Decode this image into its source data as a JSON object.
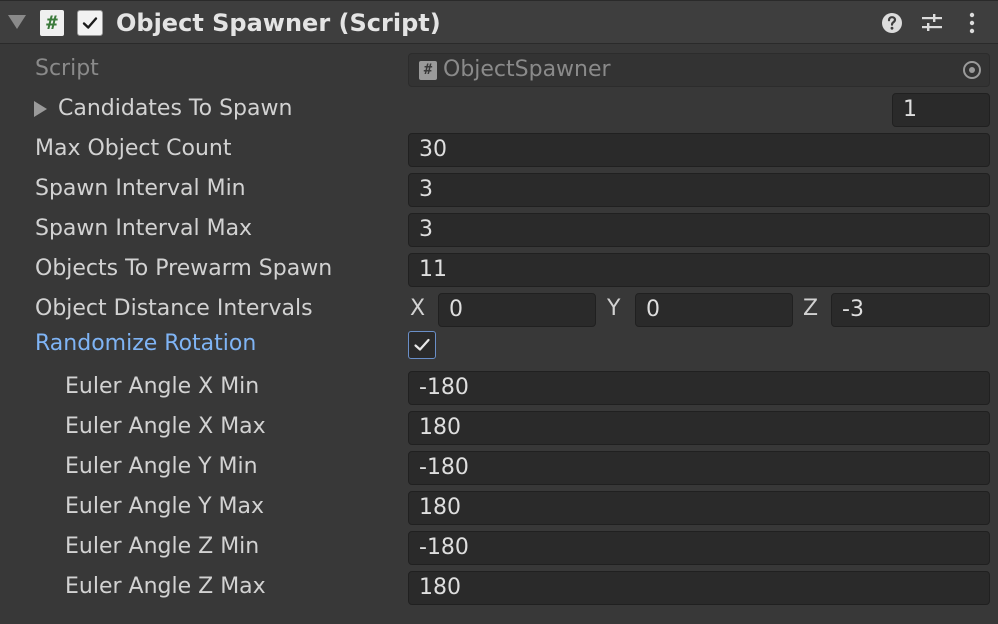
{
  "header": {
    "title": "Object Spawner (Script)",
    "script_glyph": "#",
    "enabled": true,
    "icons": [
      "help-icon",
      "preset-icon",
      "menu-icon"
    ]
  },
  "fields": {
    "script": {
      "label": "Script",
      "value": "ObjectSpawner"
    },
    "candidates": {
      "label": "Candidates To Spawn",
      "value": "1"
    },
    "max_object_count": {
      "label": "Max Object Count",
      "value": "30"
    },
    "spawn_interval_min": {
      "label": "Spawn Interval Min",
      "value": "3"
    },
    "spawn_interval_max": {
      "label": "Spawn Interval Max",
      "value": "3"
    },
    "objects_to_prewarm": {
      "label": "Objects To Prewarm Spawn",
      "value": "11"
    },
    "object_distance_intervals": {
      "label": "Object Distance Intervals",
      "x_label": "X",
      "x": "0",
      "y_label": "Y",
      "y": "0",
      "z_label": "Z",
      "z": "-3"
    },
    "randomize_rotation": {
      "label": "Randomize Rotation",
      "checked": true
    },
    "euler_x_min": {
      "label": "Euler Angle X Min",
      "value": "-180"
    },
    "euler_x_max": {
      "label": "Euler Angle X Max",
      "value": "180"
    },
    "euler_y_min": {
      "label": "Euler Angle Y Min",
      "value": "-180"
    },
    "euler_y_max": {
      "label": "Euler Angle Y Max",
      "value": "180"
    },
    "euler_z_min": {
      "label": "Euler Angle Z Min",
      "value": "-180"
    },
    "euler_z_max": {
      "label": "Euler Angle Z Max",
      "value": "180"
    }
  },
  "colors": {
    "background": "#383838",
    "field_background": "#2a2a2a",
    "highlight_label": "#7fb4f5"
  }
}
